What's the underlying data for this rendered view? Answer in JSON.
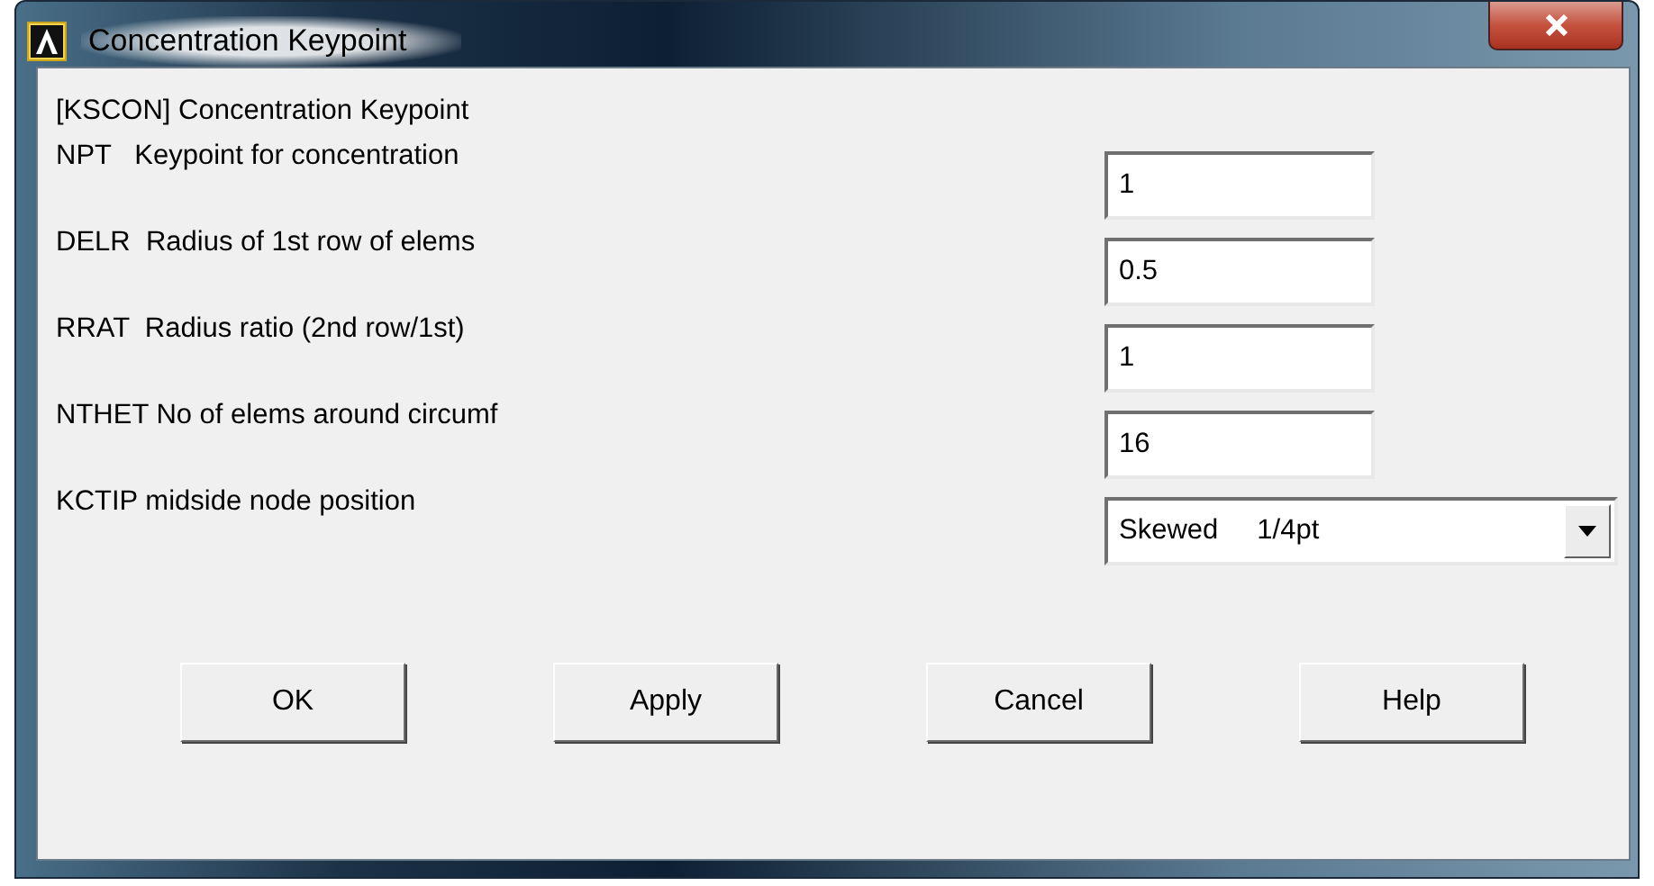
{
  "window": {
    "title": "Concentration Keypoint"
  },
  "header": "[KSCON]  Concentration Keypoint",
  "fields": [
    {
      "kind": "text",
      "label": "NPT   Keypoint for concentration",
      "value": "1"
    },
    {
      "kind": "text",
      "label": "DELR  Radius of 1st row of elems",
      "value": "0.5"
    },
    {
      "kind": "text",
      "label": "RRAT  Radius ratio (2nd row/1st)",
      "value": "1"
    },
    {
      "kind": "text",
      "label": "NTHET No of elems around circumf",
      "value": "16"
    },
    {
      "kind": "select",
      "label": "KCTIP midside node position",
      "value": "Skewed     1/4pt"
    }
  ],
  "buttons": [
    "OK",
    "Apply",
    "Cancel",
    "Help"
  ]
}
